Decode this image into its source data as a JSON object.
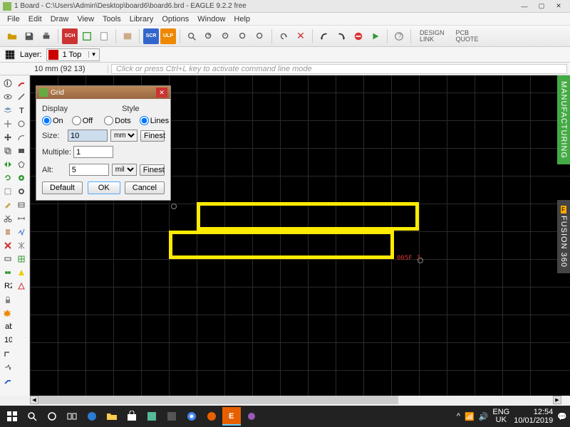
{
  "titlebar": {
    "title": "1 Board - C:\\Users\\Admin\\Desktop\\board6\\board6.brd - EAGLE 9.2.2 free"
  },
  "menu": [
    "File",
    "Edit",
    "Draw",
    "View",
    "Tools",
    "Library",
    "Options",
    "Window",
    "Help"
  ],
  "layerbar": {
    "label": "Layer:",
    "layer": "1 Top"
  },
  "status": {
    "coords": "10 mm (92 13)",
    "cmdhint": "Click or press Ctrl+L key to activate command line mode"
  },
  "toolbar_right": {
    "design_link": "DESIGN\nLINK",
    "pcb_quote": "PCB\nQUOTE"
  },
  "right_panels": {
    "mfg": "MANUFACTURING",
    "f360_badge": "F",
    "f360": "FUSION 360"
  },
  "canvas": {
    "annotation": "005F J"
  },
  "dialog": {
    "title": "Grid",
    "display_label": "Display",
    "style_label": "Style",
    "on": "On",
    "off": "Off",
    "dots": "Dots",
    "lines": "Lines",
    "size_label": "Size:",
    "size_value": "10",
    "size_unit": "mm",
    "finest": "Finest",
    "multiple_label": "Multiple:",
    "multiple_value": "1",
    "alt_label": "Alt:",
    "alt_value": "5",
    "alt_unit": "mil",
    "default": "Default",
    "ok": "OK",
    "cancel": "Cancel"
  },
  "taskbar": {
    "lang": "ENG\nUK",
    "time": "12:54",
    "date": "10/01/2019"
  }
}
